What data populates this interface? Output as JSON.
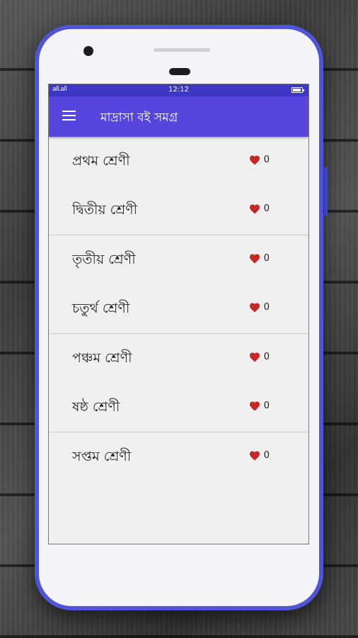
{
  "status_bar": {
    "signal": "all.all",
    "time": "12:12",
    "battery_level": 0.9
  },
  "app_bar": {
    "title": "মাদ্রাসা বই সমগ্র",
    "menu_icon": "hamburger-menu-icon"
  },
  "colors": {
    "appbar": "#5745e0",
    "statusbar": "#3d37c6",
    "phone_frame": "#4f55d6",
    "heart": "#c62828"
  },
  "classes": [
    {
      "label": "প্রথম শ্রেণী",
      "likes": "0"
    },
    {
      "label": "দ্বিতীয় শ্রেণী",
      "likes": "0"
    },
    {
      "label": "তৃতীয় শ্রেণী",
      "likes": "0"
    },
    {
      "label": "চতুর্থ শ্রেণী",
      "likes": "0"
    },
    {
      "label": "পঞ্চম শ্রেণী",
      "likes": "0"
    },
    {
      "label": "ষষ্ঠ শ্রেণী",
      "likes": "0"
    },
    {
      "label": "সপ্তম শ্রেণী",
      "likes": "0"
    }
  ]
}
